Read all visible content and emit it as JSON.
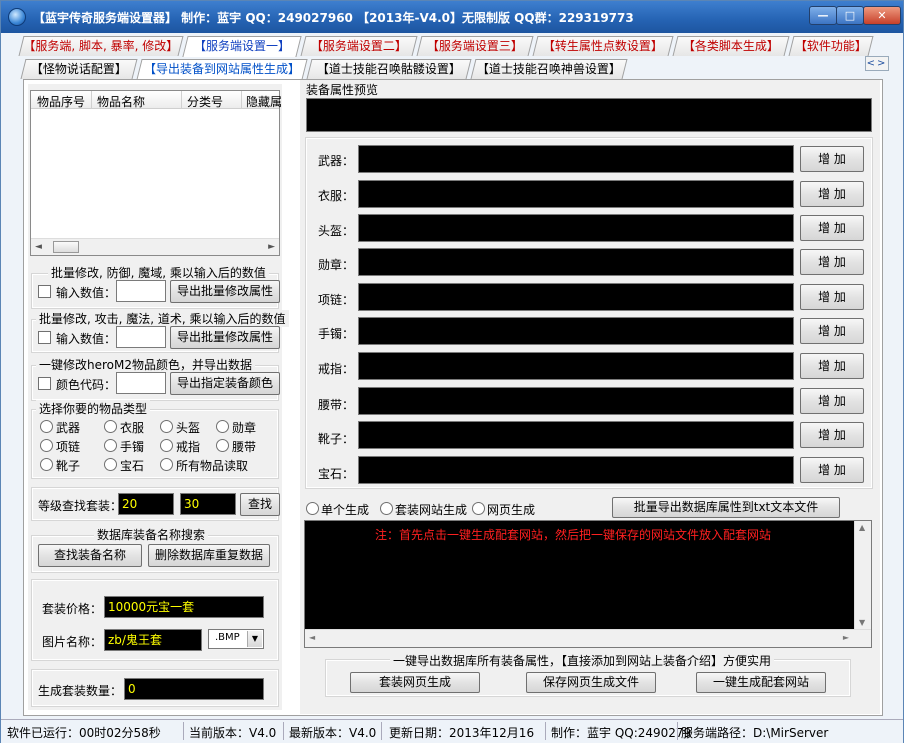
{
  "window": {
    "title": "【蓝宇传奇服务端设置器】 制作：蓝宇 QQ：249027960 【2013年-V4.0】无限制版 QQ群：229319773",
    "min_label": "—",
    "max_label": "□",
    "close_label": "✕"
  },
  "tabs_row1": [
    "【服务端, 脚本, 暴率, 修改】",
    "【服务端设置一】",
    "【服务端设置二】",
    "【服务端设置三】",
    "【转生属性点数设置】",
    "【各类脚本生成】",
    "【软件功能】"
  ],
  "tabs_row2": [
    "【怪物说话配置】",
    "【导出装备到网站属性生成】",
    "【道士技能召唤骷髅设置】",
    "【道士技能召唤神兽设置】"
  ],
  "tab_nav": "<>",
  "item_table": {
    "columns": [
      "物品序号",
      "物品名称",
      "分类号",
      "隐藏属"
    ]
  },
  "batch1": {
    "title": "批量修改, 防御, 魔域, 乘以输入后的数值",
    "label": "输入数值：",
    "button": "导出批量修改属性"
  },
  "batch2": {
    "title": "批量修改, 攻击, 魔法, 道术, 乘以输入后的数值",
    "label": "输入数值：",
    "button": "导出批量修改属性"
  },
  "color_group": {
    "title": "一键修改heroM2物品颜色，并导出数据",
    "label": "颜色代码：",
    "button": "导出指定装备颜色"
  },
  "type_group": {
    "title": "选择你要的物品类型",
    "options": [
      "武器",
      "衣服",
      "头盔",
      "勋章",
      "项链",
      "手镯",
      "戒指",
      "腰带",
      "靴子",
      "宝石",
      "所有物品读取"
    ]
  },
  "level_search": {
    "label": "等级查找套装：",
    "from": "20",
    "to": "30",
    "button": "查找"
  },
  "db_search": {
    "title": "数据库装备名称搜索",
    "find_button": "查找装备名称",
    "delete_button": "删除数据库重复数据"
  },
  "suit": {
    "price_label": "套装价格：",
    "price_value": "10000元宝一套",
    "image_label": "图片名称：",
    "image_value": "zb/鬼王套",
    "ext_value": ".BMP"
  },
  "gen_count": {
    "label": "生成套装数量：",
    "value": "0"
  },
  "preview": {
    "title": "装备属性预览"
  },
  "equip": {
    "slots": [
      "武器：",
      "衣服：",
      "头盔：",
      "勋章：",
      "项链：",
      "手镯：",
      "戒指：",
      "腰带：",
      "靴子：",
      "宝石："
    ],
    "add_label": "增 加"
  },
  "gen_mode": {
    "options": [
      "单个生成",
      "套装网站生成",
      "网页生成"
    ],
    "export_button": "批量导出数据库属性到txt文本文件"
  },
  "notice": "注：首先点击一键生成配套网站，然后把一键保存的网站文件放入配套网站",
  "bottom": {
    "desc": "一键导出数据库所有装备属性，【直接添加到网站上装备介绍】方便实用",
    "buttons": [
      "套装网页生成",
      "保存网页生成文件",
      "一键生成配套网站"
    ]
  },
  "status": {
    "runtime": "软件已运行：00时02分58秒",
    "current_version": "当前版本：V4.0",
    "latest_version": "最新版本：V4.0",
    "update_date": "更新日期：2013年12月16",
    "author": "制作：蓝宇 QQ:2490279",
    "server_path": "服务端路径：D:\\MirServer"
  },
  "colors": {
    "title_bar": "#2563b3",
    "dark_field": "#000000",
    "yellow_text": "#ffff00",
    "notice_red": "#ff2020"
  }
}
